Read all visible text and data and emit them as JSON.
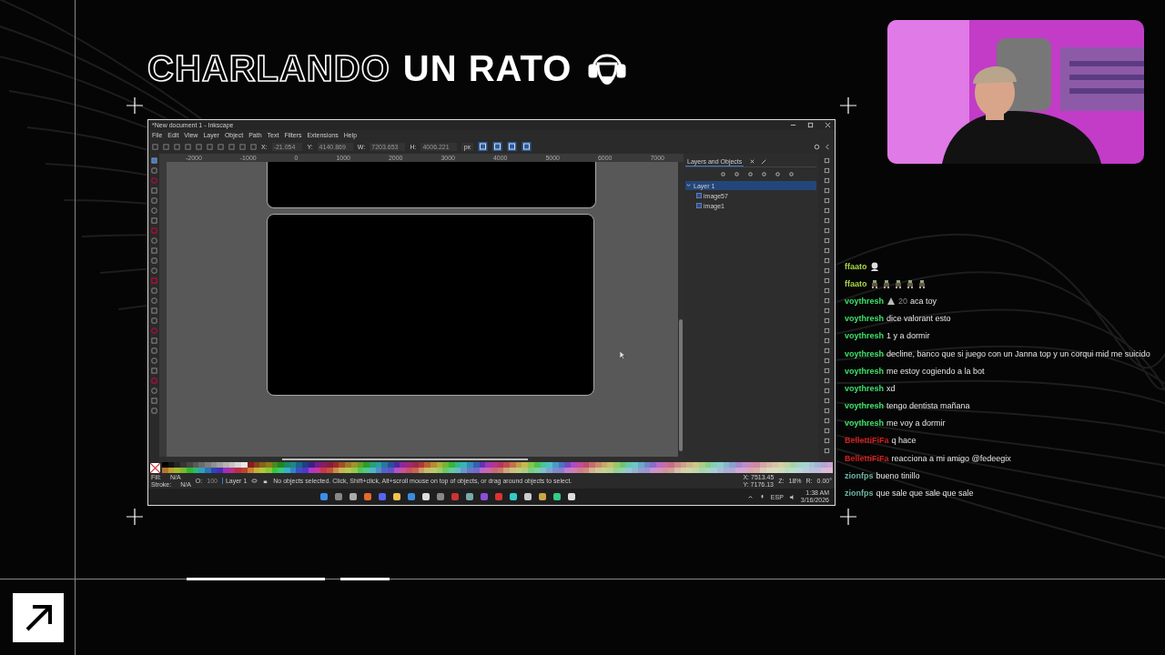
{
  "title": {
    "outline": "CHARLANDO",
    "solid": "UN RATO"
  },
  "editor": {
    "window_title": "*New document 1 - Inkscape",
    "menu": [
      "File",
      "Edit",
      "View",
      "Layer",
      "Object",
      "Path",
      "Text",
      "Filters",
      "Extensions",
      "Help"
    ],
    "fields": [
      {
        "label": "X:",
        "value": "-21.054"
      },
      {
        "label": "Y:",
        "value": "4140.869"
      },
      {
        "label": "W:",
        "value": "7203.653"
      },
      {
        "label": "H:",
        "value": "4006.221"
      }
    ],
    "unit": "px",
    "ruler_labels": [
      "-2000",
      "-1000",
      "0",
      "1000",
      "2000",
      "3000",
      "4000",
      "5000",
      "6000",
      "7000"
    ],
    "panel": {
      "tab": "Layers and Objects",
      "layers": [
        {
          "name": "Layer 1",
          "expanded": true,
          "selected": true,
          "children": [
            {
              "name": "image57",
              "selected": false
            },
            {
              "name": "image1",
              "selected": false
            }
          ]
        }
      ]
    },
    "status": {
      "fill_label": "Fill:",
      "fill": "N/A",
      "stroke_label": "Stroke:",
      "stroke": "N/A",
      "opacity_label": "O:",
      "opacity": "100",
      "layer": "Layer 1",
      "message": "No objects selected. Click, Shift+click, Alt+scroll mouse on top of objects, or drag around objects to select.",
      "x": "X: 7513.45",
      "y": "Y: 7176.13",
      "zoom_label": "Z:",
      "zoom": "18%",
      "rotate_label": "R:",
      "rotation": "0.00°"
    },
    "taskbar": {
      "language": "ESP",
      "time": "1:38 AM",
      "date": "3/16/2026"
    }
  },
  "chat": [
    {
      "user": "ffaato",
      "color": "#a8d64a",
      "emotes": [
        {
          "kind": "avatar"
        }
      ]
    },
    {
      "user": "ffaato",
      "color": "#a8d64a",
      "emotes": [
        {
          "kind": "sprite"
        },
        {
          "kind": "sprite"
        },
        {
          "kind": "sprite"
        },
        {
          "kind": "sprite"
        },
        {
          "kind": "sprite"
        }
      ]
    },
    {
      "user": "voythresh",
      "color": "#3ee06a",
      "badge": "20",
      "text": "aca toy"
    },
    {
      "user": "voythresh",
      "color": "#3ee06a",
      "text": "dice valorant esto"
    },
    {
      "user": "voythresh",
      "color": "#3ee06a",
      "text": "1 y a dormir"
    },
    {
      "user": "voythresh",
      "color": "#3ee06a",
      "text": "decline, banco que si juego con un Janna top y un corqui mid me suicido"
    },
    {
      "user": "voythresh",
      "color": "#3ee06a",
      "text": "me estoy cogiendo a la bot"
    },
    {
      "user": "voythresh",
      "color": "#3ee06a",
      "text": "xd"
    },
    {
      "user": "voythresh",
      "color": "#3ee06a",
      "text": "tengo dentista mañana"
    },
    {
      "user": "voythresh",
      "color": "#3ee06a",
      "text": "me voy a dormir"
    },
    {
      "user": "BellettiFiFa",
      "color": "#d42020",
      "text": "q hace"
    },
    {
      "user": "BellettiFiFa",
      "color": "#d42020",
      "text": "reacciona a mi amigo @fedeegix"
    },
    {
      "user": "zionfps",
      "color": "#6fb3a3",
      "text": "bueno tinillo"
    },
    {
      "user": "zionfps",
      "color": "#6fb3a3",
      "text": "que sale que sale que sale"
    }
  ]
}
